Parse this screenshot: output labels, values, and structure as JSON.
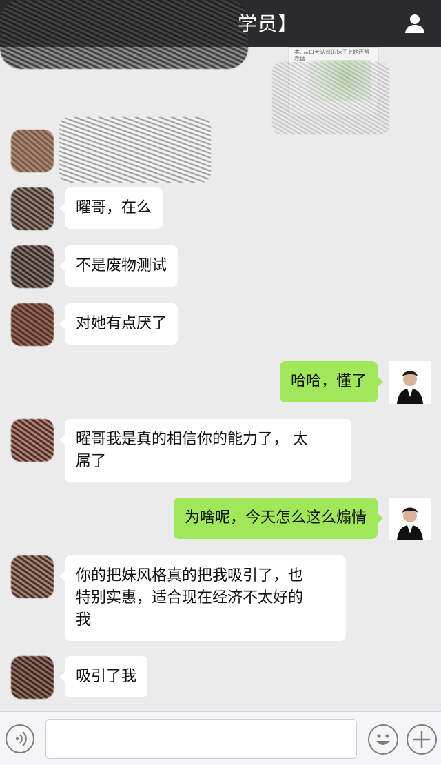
{
  "header": {
    "title": "学员】",
    "profile_icon": "person-icon"
  },
  "shared_card": {
    "snippet": "本, 从白天认识的妹子上她还帮我做"
  },
  "messages": [
    {
      "side": "left",
      "text": "曜哥，在么"
    },
    {
      "side": "left",
      "text": "不是废物测试"
    },
    {
      "side": "left",
      "text": "对她有点厌了"
    },
    {
      "side": "right",
      "text": "哈哈，懂了"
    },
    {
      "side": "left",
      "line1": "曜哥我是真的相信你的能力了， 太",
      "line2": "屌了"
    },
    {
      "side": "right",
      "text": "为啥呢，今天怎么这么煽情"
    },
    {
      "side": "left",
      "line1": "你的把妹风格真的把我吸引了，也",
      "line2": "特别实惠，适合现在经济不太好的",
      "line3": "我"
    },
    {
      "side": "left",
      "text": "吸引了我"
    }
  ],
  "input_bar": {
    "placeholder": "",
    "icons": [
      "voice-icon",
      "emoji-icon",
      "plus-icon"
    ]
  },
  "colors": {
    "header_bg": "#2b2b2d",
    "chat_bg": "#ebebeb",
    "outgoing_bubble": "#a0e75a",
    "incoming_bubble": "#ffffff"
  }
}
